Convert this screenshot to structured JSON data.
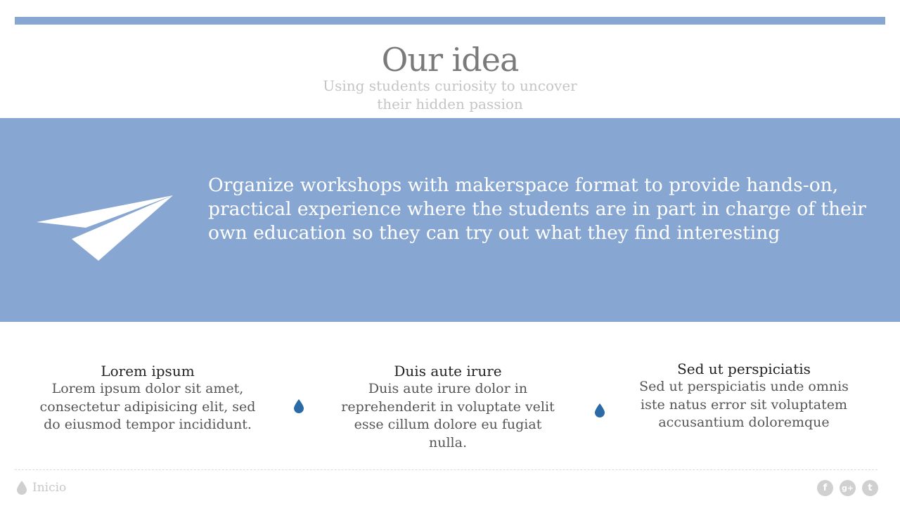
{
  "header": {
    "title": "Our idea",
    "subtitle_line1": "Using students curiosity to uncover",
    "subtitle_line2": "their hidden passion"
  },
  "band": {
    "icon": "paper-plane-icon",
    "text": "Organize workshops with makerspace format to provide hands-on, practical experience where the students are in part in charge of their own education so they can try out what they find interesting"
  },
  "features": [
    {
      "title": "Lorem ipsum",
      "body": "Lorem ipsum dolor sit amet, consectetur adipisicing elit, sed do eiusmod tempor incididunt."
    },
    {
      "title": "Duis aute irure",
      "body": "Duis aute irure dolor in reprehenderit in voluptate velit esse cillum dolore eu fugiat nulla."
    },
    {
      "title": "Sed ut perspiciatis",
      "body": "Sed ut perspiciatis unde omnis iste natus error sit voluptatem accusantium doloremque"
    }
  ],
  "footer": {
    "home_label": "Inicio",
    "social": {
      "facebook": "f",
      "googleplus": "g+",
      "twitter": "t"
    }
  },
  "colors": {
    "accent": "#87a7d2",
    "drop": "#2a6aa6",
    "muted": "#c8c8c8"
  }
}
